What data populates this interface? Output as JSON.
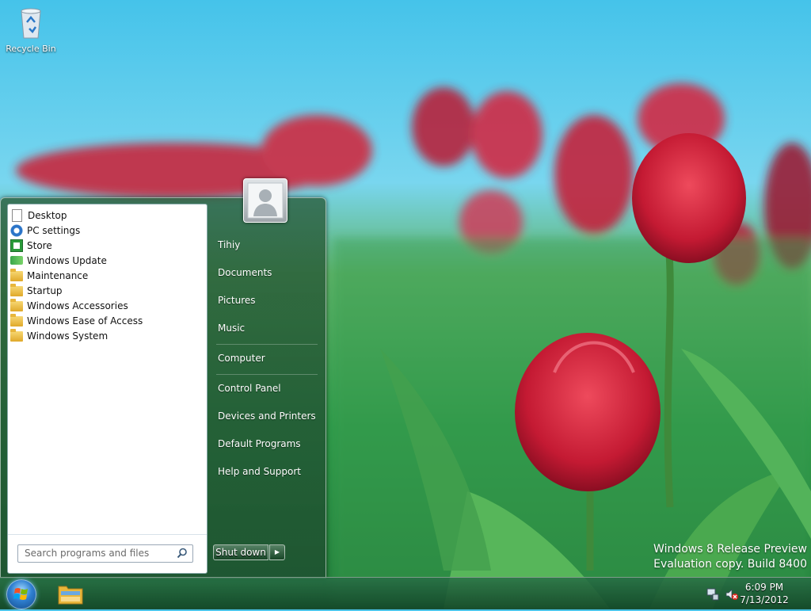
{
  "desktop": {
    "icons": [
      {
        "label": "Recycle Bin",
        "icon": "recycle-bin-icon"
      }
    ],
    "watermark": {
      "line1": "Windows 8 Release Preview",
      "line2": "Evaluation copy. Build 8400"
    }
  },
  "start_menu": {
    "programs": [
      {
        "label": "Desktop",
        "icon": "document-icon"
      },
      {
        "label": "PC settings",
        "icon": "gear-icon"
      },
      {
        "label": "Store",
        "icon": "store-icon"
      },
      {
        "label": "Windows Update",
        "icon": "windows-update-icon"
      },
      {
        "label": "Maintenance",
        "icon": "folder-icon"
      },
      {
        "label": "Startup",
        "icon": "folder-icon"
      },
      {
        "label": "Windows Accessories",
        "icon": "folder-icon"
      },
      {
        "label": "Windows Ease of Access",
        "icon": "folder-icon"
      },
      {
        "label": "Windows System",
        "icon": "folder-icon"
      }
    ],
    "search": {
      "placeholder": "Search programs and files"
    },
    "right_items": [
      {
        "label": "Tihiy"
      },
      {
        "label": "Documents"
      },
      {
        "label": "Pictures"
      },
      {
        "label": "Music"
      },
      {
        "label": "Computer"
      },
      {
        "label": "Control Panel"
      },
      {
        "label": "Devices and Printers"
      },
      {
        "label": "Default Programs"
      },
      {
        "label": "Help and Support"
      }
    ],
    "shutdown_label": "Shut down"
  },
  "taskbar": {
    "clock": {
      "time": "6:09 PM",
      "date": "7/13/2012"
    },
    "tray_icons": [
      "network-icon",
      "volume-muted-icon"
    ],
    "pinned": [
      "windows-explorer-icon"
    ]
  }
}
